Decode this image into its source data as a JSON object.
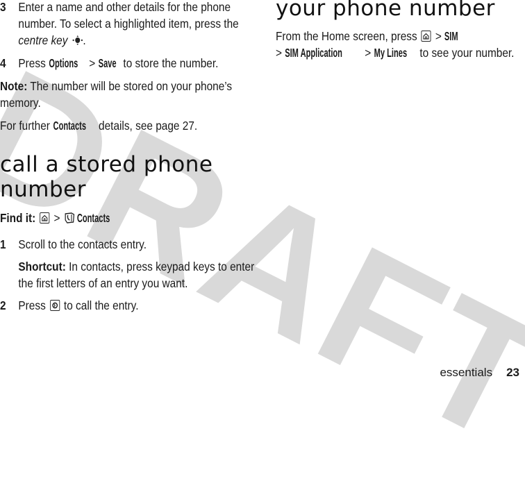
{
  "watermark": "DRAFT",
  "left_column": {
    "step3": {
      "number": "3",
      "text_a": "Enter a name and other details for the phone number. To select a highlighted item, press the ",
      "centre_key_label": "centre key",
      "text_b": "."
    },
    "step4": {
      "number": "4",
      "press": "Press ",
      "cmd1": "Options",
      "sep": " > ",
      "cmd2": "Save",
      "text": " to store the number."
    },
    "note": {
      "label": "Note:",
      "text": " The number will be stored on your phone’s memory."
    },
    "further": {
      "text_a": "For further ",
      "cmd": "Contacts",
      "text_b": " details, see page 27."
    },
    "section_heading": "call a stored phone number",
    "find_it": {
      "label": "Find it:",
      "sep": " > ",
      "cmd": "Contacts"
    },
    "step1": {
      "number": "1",
      "text": "Scroll to the contacts entry."
    },
    "shortcut": {
      "label": "Shortcut:",
      "text": " In contacts, press keypad keys to enter the first letters of an entry you want."
    },
    "step2": {
      "number": "2",
      "press": "Press ",
      "text": " to call the entry."
    }
  },
  "right_column": {
    "section_heading": "your phone number",
    "para": {
      "text_a": "From the Home screen, press ",
      "sep": " > ",
      "cmd1": "SIM",
      "cmd2": "SIM Application",
      "cmd3": "My Lines",
      "text_b": " to see your number."
    }
  },
  "footer": {
    "section": "essentials",
    "page_number": "23"
  }
}
